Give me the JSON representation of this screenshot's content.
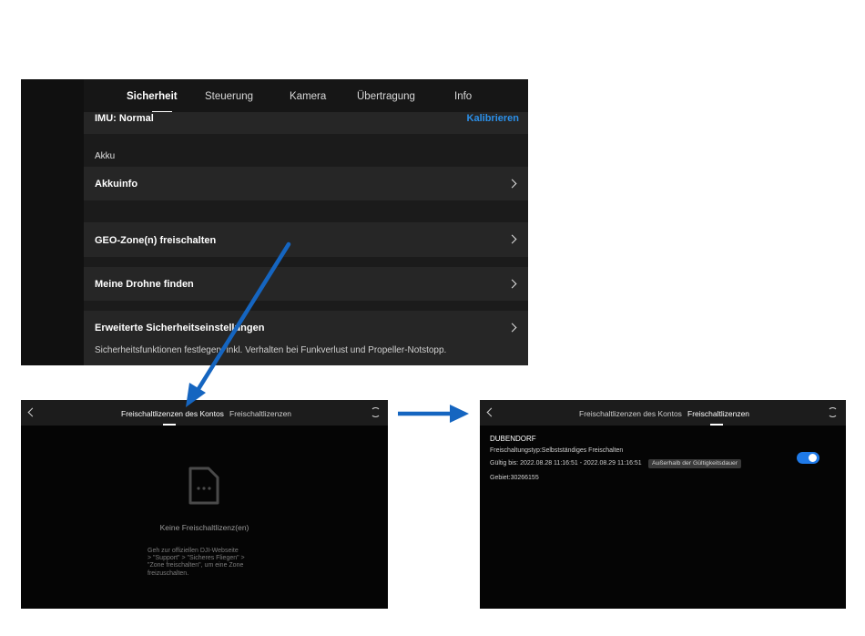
{
  "settings": {
    "tabs": [
      "Sicherheit",
      "Steuerung",
      "Kamera",
      "Übertragung",
      "Info"
    ],
    "active_tab": "Sicherheit",
    "imu_label": "IMU: Normal",
    "imu_action": "Kalibrieren",
    "akku_section": "Akku",
    "akkuinfo": "Akkuinfo",
    "geo_zone": "GEO-Zone(n) freischalten",
    "find_drone": "Meine Drohne finden",
    "advanced_title": "Erweiterte Sicherheitseinstellungen",
    "advanced_desc": "Sicherheitsfunktionen festlegen, inkl. Verhalten bei Funkverlust und Propeller-Notstopp."
  },
  "licenses_empty": {
    "tab_account": "Freischaltlizenzen des Kontos",
    "tab_licenses": "Freischaltlizenzen",
    "active_tab": "Freischaltlizenzen des Kontos",
    "empty_title": "Keine Freischaltlizenz(en)",
    "hint_lines": [
      "Geh zur offiziellen DJI-Webseite",
      "> \"Support\" > \"Sicheres Fliegen\" >",
      "\"Zone freischalten\", um eine Zone",
      "freizuschalten."
    ]
  },
  "licenses_detail": {
    "tab_account": "Freischaltlizenzen des Kontos",
    "tab_licenses": "Freischaltlizenzen",
    "active_tab": "Freischaltlizenzen",
    "name": "DUBENDORF",
    "type": "Freischaltungstyp:Selbstständiges Freischalten",
    "valid": "Gültig bis: 2022.08.28 11:16:51 - 2022.08.29 11:16:51",
    "badge": "Außerhalb der Gültigkeitsdauer",
    "area": "Gebiet:30266155",
    "enabled": true
  },
  "colors": {
    "accent": "#1f7ae8",
    "arrow": "#1565c0"
  }
}
